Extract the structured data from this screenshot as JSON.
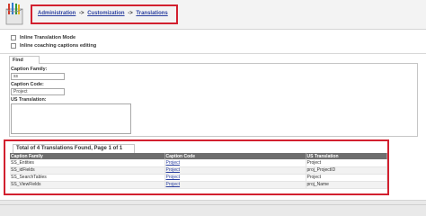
{
  "breadcrumb": {
    "items": [
      "Administration",
      "Customization",
      "Translations"
    ],
    "separator": "->"
  },
  "options": {
    "inline_translation_mode": "Inline Translation Mode",
    "inline_coaching": "Inline coaching captions editing"
  },
  "find": {
    "tab_label": "Find",
    "caption_family_label": "Caption Family:",
    "caption_family_value": "ss",
    "caption_code_label": "Caption Code:",
    "caption_code_value": "Project",
    "us_translation_label": "US Translation:"
  },
  "results": {
    "tab_label": "Total of 4 Translations Found, Page 1 of 1",
    "columns": [
      "Caption Family",
      "Caption Code",
      "US Translation"
    ],
    "rows": [
      [
        "SS_Entities",
        "Project",
        "Project"
      ],
      [
        "SS_idFields",
        "Project",
        "proj_ProjectID"
      ],
      [
        "SS_SearchTables",
        "Project",
        "Project"
      ],
      [
        "SS_ViewFields",
        "Project",
        "proj_Name"
      ]
    ]
  },
  "colors": {
    "highlight": "#d2202f",
    "link": "#2a3f9f",
    "table_header": "#6e6e6e"
  }
}
